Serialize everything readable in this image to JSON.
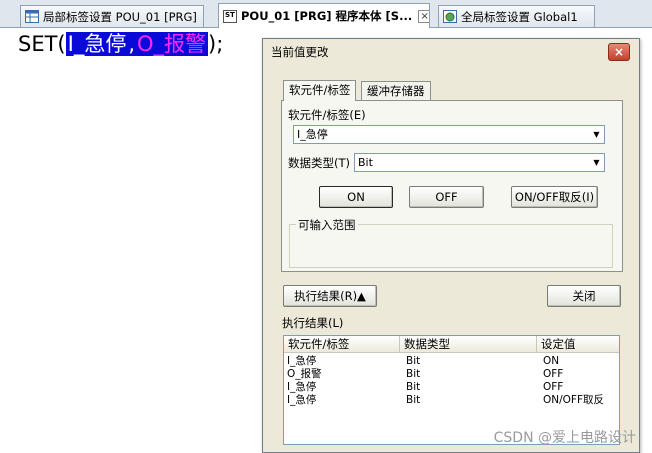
{
  "tabs": [
    {
      "label": "局部标签设置 POU_01 [PRG]",
      "icon": "table-icon"
    },
    {
      "label": "POU_01 [PRG] 程序本体 [S...",
      "icon": "st-program-icon",
      "badge": "ST",
      "close": "×",
      "active": true
    },
    {
      "label": "全局标签设置 Global1",
      "icon": "globe-table-icon"
    }
  ],
  "code": {
    "prefix": "SET(",
    "arg1": "I_急停",
    "sep": ",",
    "arg2": "O_报警",
    "suffix": ");"
  },
  "dialog": {
    "title": "当前值更改",
    "close": "×",
    "tabs": [
      "软元件/标签",
      "缓冲存储器"
    ],
    "device_label": "软元件/标签(E)",
    "device_value": "I_急停",
    "datatype_label": "数据类型(T)",
    "datatype_value": "Bit",
    "buttons": {
      "on": "ON",
      "off": "OFF",
      "toggle": "ON/OFF取反(I)"
    },
    "range_group": "可输入范围",
    "exec_result_button": "执行结果(R)▲",
    "close_button": "关闭",
    "results_label": "执行结果(L)",
    "results_columns": [
      "软元件/标签",
      "数据类型",
      "设定值"
    ],
    "results_rows": [
      [
        "I_急停",
        "Bit",
        "ON"
      ],
      [
        "O_报警",
        "Bit",
        "OFF"
      ],
      [
        "I_急停",
        "Bit",
        "OFF"
      ],
      [
        "I_急停",
        "Bit",
        "ON/OFF取反"
      ]
    ]
  },
  "watermark": "CSDN @爱上电路设计"
}
